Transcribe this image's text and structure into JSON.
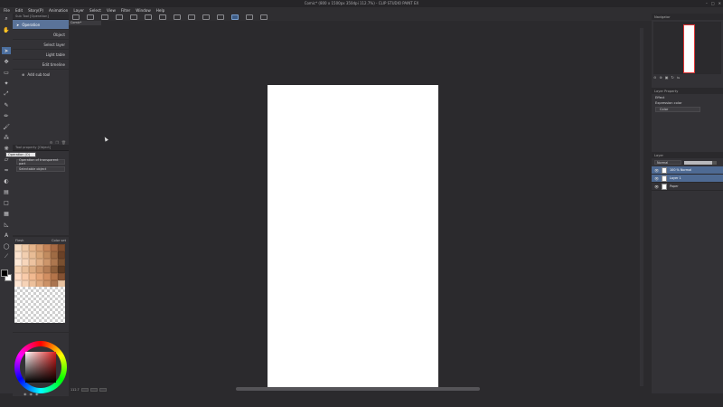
{
  "titlebar": {
    "title": "Comic* (800 x 1500px 350dpi 112.7%) - CLIP STUDIO PAINT EX",
    "controls": [
      "–",
      "□",
      "✕"
    ]
  },
  "menubar": {
    "items": [
      "File",
      "Edit",
      "Story(P)",
      "Animation",
      "Layer",
      "Select",
      "View",
      "Filter",
      "Window",
      "Help"
    ]
  },
  "subtool": {
    "header": "Sub Tool [Operation]",
    "items": [
      {
        "label": "Operation",
        "selected": true
      },
      {
        "label": "Object",
        "selected": false,
        "right": true
      },
      {
        "label": "Select layer",
        "selected": false,
        "right": true
      },
      {
        "label": "Light table",
        "selected": false,
        "right": true
      },
      {
        "label": "Edit timeline",
        "selected": false,
        "right": true
      }
    ],
    "add_label": "Add sub tool"
  },
  "toolprop": {
    "header": "Tool property [Object]",
    "tooltip": "Operation (O)",
    "field1": "Operation of transparent part",
    "field2": "Selectable object"
  },
  "colorset": {
    "header": "Color set",
    "set_name": "Flesh",
    "colors": [
      "#f6dcc2",
      "#efc9a6",
      "#e6b48a",
      "#d79e72",
      "#c48459",
      "#a76a44",
      "#7d4c2d",
      "#fbe3cf",
      "#f2cfb0",
      "#e8bc95",
      "#d9a679",
      "#c28c60",
      "#9f6b44",
      "#6a4127",
      "#ffe9d7",
      "#f7d6bb",
      "#edc3a0",
      "#e0ae85",
      "#cd966b",
      "#ad774f",
      "#7a5030",
      "#f5d3b5",
      "#e9bf9a",
      "#dcab81",
      "#cc956a",
      "#b57d55",
      "#8f5f3b",
      "#5c3a22",
      "#ffdcc4",
      "#f9cbaa",
      "#f1b990",
      "#e5a578",
      "#d28f62",
      "#b4744a",
      "#845233",
      "#fde6d4",
      "#f6d3b7",
      "#ecc09b",
      "#dfaa80",
      "#cc9267",
      "#aa7550",
      "#e8c3a1"
    ]
  },
  "canvas": {
    "tab_label": "Comic*",
    "zoom": "112.7"
  },
  "navigator": {
    "header": "Navigator"
  },
  "layer_property": {
    "header": "Layer Property",
    "effect_label": "Effect",
    "expression_label": "Expression color",
    "expression_value": "Color"
  },
  "layers": {
    "header": "Layer",
    "blend_mode": "Normal",
    "opacity": 100,
    "rows": [
      {
        "name": "100 % Normal",
        "selected": true
      },
      {
        "name": "Layer 1",
        "selected": true
      },
      {
        "name": "Paper",
        "selected": false
      }
    ]
  }
}
